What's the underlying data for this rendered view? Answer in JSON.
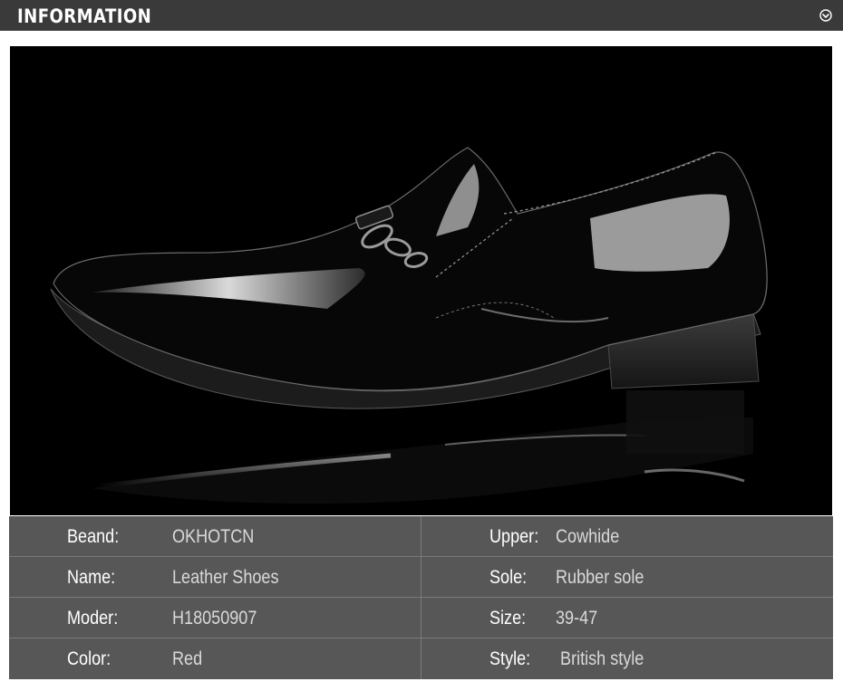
{
  "header": {
    "title": "INFORMATION",
    "collapse_icon": "chevron-down-circle-icon"
  },
  "product_image": {
    "icon": "black-patent-leather-loafer-photo"
  },
  "specs": {
    "rows": [
      {
        "left_label": "Beand:",
        "left_value": "OKHOTCN",
        "right_label": "Upper:",
        "right_value": "Cowhide"
      },
      {
        "left_label": "Name:",
        "left_value": "Leather Shoes",
        "right_label": "Sole:",
        "right_value": "Rubber sole"
      },
      {
        "left_label": "Moder:",
        "left_value": "H18050907",
        "right_label": "Size:",
        "right_value": "39-47"
      },
      {
        "left_label": "Color:",
        "left_value": "Red",
        "right_label": "Style:",
        "right_value": " British style"
      }
    ]
  },
  "colors": {
    "header_bg": "#3a3a3a",
    "table_bg": "#575757",
    "table_lines": "#7a7a7a",
    "label_text": "#ffffff",
    "value_text": "#d9d9d9"
  }
}
